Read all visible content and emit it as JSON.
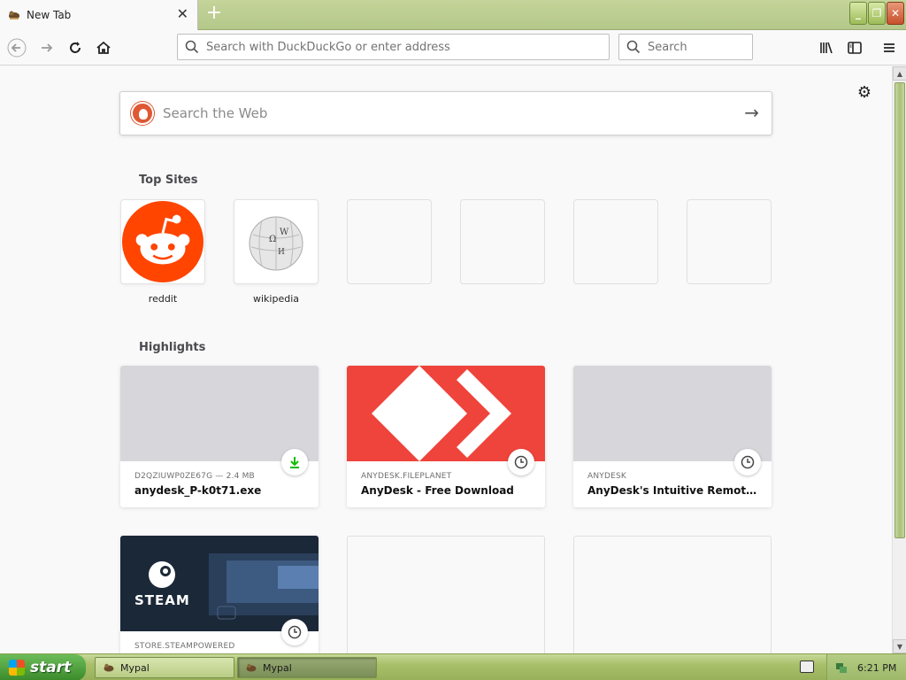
{
  "browser": {
    "tab_title": "New Tab",
    "tab_close": "✕",
    "new_tab": "+",
    "url_placeholder": "Search with DuckDuckGo or enter address",
    "search_placeholder": "Search",
    "window_buttons": [
      "_",
      "❐",
      "✕"
    ]
  },
  "newtab": {
    "websearch_placeholder": "Search the Web",
    "top_sites_title": "Top Sites",
    "top_sites": [
      {
        "label": "reddit",
        "icon": "reddit-icon"
      },
      {
        "label": "wikipedia",
        "icon": "wikipedia-icon"
      },
      {
        "label": ""
      },
      {
        "label": ""
      },
      {
        "label": ""
      },
      {
        "label": ""
      }
    ],
    "highlights_title": "Highlights",
    "highlights": [
      {
        "host": "D2QZIUWP0ZE67G — 2.4 MB",
        "title": "anydesk_P-k0t71.exe",
        "badge": "download-icon"
      },
      {
        "host": "ANYDESK.FILEPLANET",
        "title": "AnyDesk - Free Download",
        "badge": "clock-icon"
      },
      {
        "host": "ANYDESK",
        "title": "AnyDesk's Intuitive Remote Des...",
        "badge": "clock-icon"
      },
      {
        "host": "STORE.STEAMPOWERED",
        "title": "",
        "badge": "clock-icon",
        "logo_text": "STEAM"
      }
    ]
  },
  "taskbar": {
    "start_label": "start",
    "items": [
      {
        "label": "Mypal"
      },
      {
        "label": "Mypal"
      }
    ],
    "clock": "6:21 PM"
  },
  "colors": {
    "reddit": "#ff4500",
    "anydesk": "#ef443b",
    "steam_bg": "#1b2838",
    "xp_green": "#a8c06a"
  }
}
